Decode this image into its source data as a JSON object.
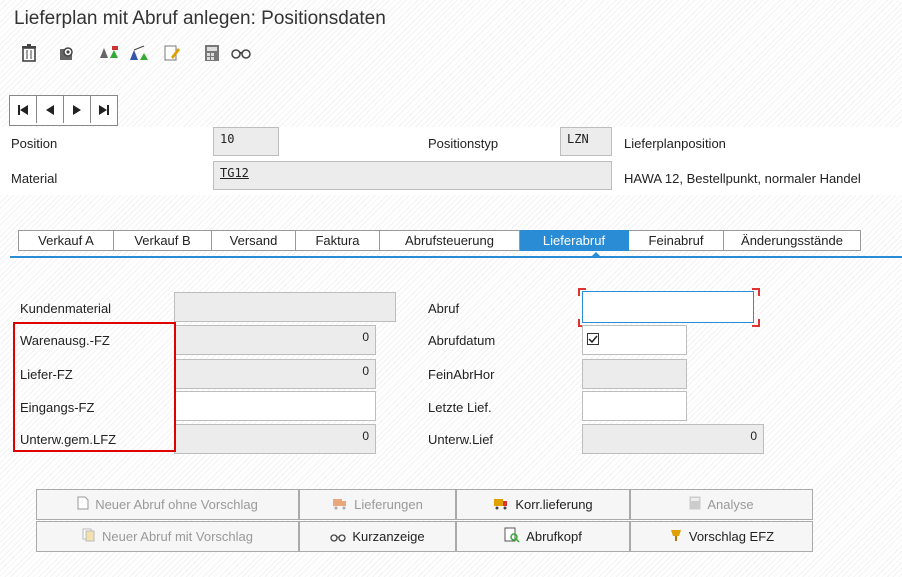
{
  "title": "Lieferplan mit Abruf anlegen: Positionsdaten",
  "toolbar": {
    "icons": [
      "trash-icon",
      "view-icon",
      "scales-icon",
      "balance-icon",
      "edit-note-icon",
      "calculator-icon",
      "glasses-icon"
    ]
  },
  "header": {
    "position_label": "Position",
    "position_value": "10",
    "positionstyp_label": "Positionstyp",
    "positionstyp_value": "LZN",
    "positionstyp_text": "Lieferplanposition",
    "material_label": "Material",
    "material_value": "TG12",
    "material_text": "HAWA 12, Bestellpunkt, normaler Handel"
  },
  "tabs": [
    {
      "label": "Verkauf A"
    },
    {
      "label": "Verkauf B"
    },
    {
      "label": "Versand"
    },
    {
      "label": "Faktura"
    },
    {
      "label": "Abrufsteuerung"
    },
    {
      "label": "Lieferabruf"
    },
    {
      "label": "Feinabruf"
    },
    {
      "label": "Änderungsstände"
    }
  ],
  "active_tab": "Lieferabruf",
  "fields": {
    "kundenmaterial_label": "Kundenmaterial",
    "kundenmaterial_value": "",
    "warenausg_label": "Warenausg.-FZ",
    "warenausg_value": "0",
    "liefer_label": "Liefer-FZ",
    "liefer_value": "0",
    "eingangs_label": "Eingangs-FZ",
    "eingangs_value": "",
    "unterw_label": "Unterw.gem.LFZ",
    "unterw_value": "0",
    "abruf_label": "Abruf",
    "abruf_value": "",
    "abrufdatum_label": "Abrufdatum",
    "abrufdatum_checked": true,
    "feinabrhor_label": "FeinAbrHor",
    "feinabrhor_value": "",
    "letzte_lief_label": "Letzte Lief.",
    "letzte_lief_value": "",
    "unterw_lief_label": "Unterw.Lief",
    "unterw_lief_value": "0"
  },
  "buttons": {
    "neuer_ohne": "Neuer Abruf ohne Vorschlag",
    "lieferungen": "Lieferungen",
    "korr_lieferung": "Korr.lieferung",
    "analyse": "Analyse",
    "neuer_mit": "Neuer Abruf mit Vorschlag",
    "kurzanzeige": "Kurzanzeige",
    "abrufkopf": "Abrufkopf",
    "vorschlag_efz": "Vorschlag EFZ"
  },
  "colors": {
    "accent": "#2b8cd6",
    "highlight_red": "#e00000"
  }
}
